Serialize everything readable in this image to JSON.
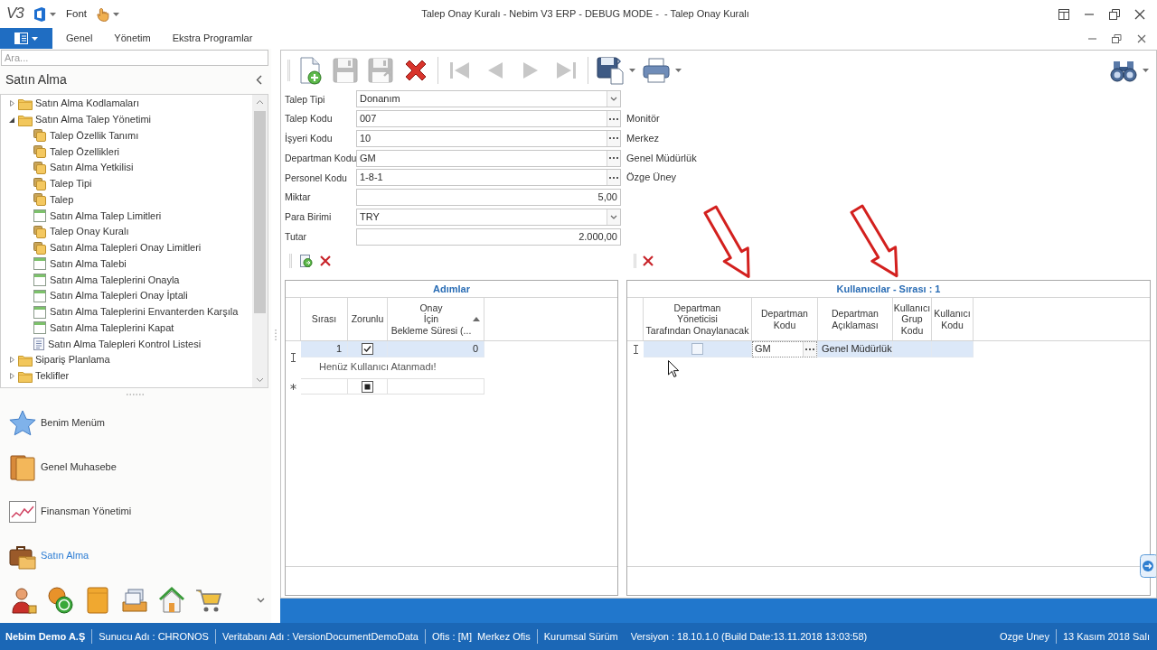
{
  "title_bar": {
    "logo": "V3",
    "menu_label": "Font",
    "title": "Talep Onay Kuralı - Nebim V3 ERP - DEBUG MODE -  - Talep Onay Kuralı"
  },
  "ribbon_tabs": [
    {
      "label": "Genel",
      "selected": false
    },
    {
      "label": "Yönetim",
      "selected": false
    },
    {
      "label": "Ekstra Programlar",
      "selected": false
    }
  ],
  "sidebar": {
    "search": {
      "placeholder": "Ara..."
    },
    "title": "Satın Alma",
    "tree": [
      {
        "label": "Satın Alma Kodlamaları",
        "kind": "folder",
        "expanded": false
      },
      {
        "label": "Satın Alma Talep Yönetimi",
        "kind": "folder",
        "expanded": true,
        "children": [
          {
            "label": "Talep Özellik Tanımı",
            "kind": "module"
          },
          {
            "label": "Talep Özellikleri",
            "kind": "module"
          },
          {
            "label": "Satın Alma Yetkilisi",
            "kind": "module"
          },
          {
            "label": "Talep Tipi",
            "kind": "module"
          },
          {
            "label": "Talep",
            "kind": "module"
          },
          {
            "label": "Satın Alma Talep Limitleri",
            "kind": "form"
          },
          {
            "label": "Talep Onay Kuralı",
            "kind": "module"
          },
          {
            "label": "Satın Alma Talepleri Onay Limitleri",
            "kind": "module"
          },
          {
            "label": "Satın Alma Talebi",
            "kind": "form"
          },
          {
            "label": "Satın Alma Taleplerini Onayla",
            "kind": "form"
          },
          {
            "label": "Satın Alma Talepleri Onay İptali",
            "kind": "form"
          },
          {
            "label": "Satın Alma Taleplerini Envanterden Karşıla",
            "kind": "form"
          },
          {
            "label": "Satın Alma Taleplerini Kapat",
            "kind": "form"
          },
          {
            "label": "Satın Alma Talepleri Kontrol Listesi",
            "kind": "report"
          }
        ]
      },
      {
        "label": "Sipariş Planlama",
        "kind": "folder",
        "expanded": false
      },
      {
        "label": "Teklifler",
        "kind": "folder",
        "expanded": false
      }
    ],
    "nav": [
      {
        "label": "Benim Menüm",
        "selected": false
      },
      {
        "label": "Genel Muhasebe",
        "selected": false
      },
      {
        "label": "Finansman Yönetimi",
        "selected": false
      },
      {
        "label": "Satın Alma",
        "selected": true
      }
    ]
  },
  "toolbar": [
    {
      "disabled": false
    },
    {
      "disabled": true
    },
    {
      "disabled": true
    },
    {
      "disabled": false
    },
    {
      "disabled": true
    },
    {
      "disabled": true
    },
    {
      "disabled": true
    },
    {
      "disabled": true
    },
    {
      "disabled": false
    },
    {
      "disabled": false
    },
    {
      "disabled": false
    }
  ],
  "form": {
    "fields": [
      {
        "label": "Talep Tipi",
        "value": "Donanım",
        "kind": "dropdown"
      },
      {
        "label": "Talep Kodu",
        "value": "007",
        "kind": "lookup",
        "description": "Monitör"
      },
      {
        "label": "İşyeri Kodu",
        "value": "10",
        "kind": "lookup",
        "description": "Merkez"
      },
      {
        "label": "Departman Kodu",
        "value": "GM",
        "kind": "lookup",
        "description": "Genel Müdürlük"
      },
      {
        "label": "Personel Kodu",
        "value": "1-8-1",
        "kind": "lookup",
        "description": "Özge Üney"
      },
      {
        "label": "Miktar",
        "value": "5,00",
        "kind": "number"
      },
      {
        "label": "Para Birimi",
        "value": "TRY",
        "kind": "dropdown"
      },
      {
        "label": "Tutar",
        "value": "2.000,00",
        "kind": "number"
      }
    ]
  },
  "steps": {
    "title": "Adımlar",
    "columns": [
      {
        "label": "Sırası",
        "kind": "number"
      },
      {
        "label": "Zorunlu",
        "kind": "checkbox"
      },
      {
        "label": "Onay\nİçin\nBekleme Süresi (...",
        "kind": "number",
        "sorted": true
      }
    ],
    "rows": [
      {
        "kind": "data",
        "selected": true,
        "editing": true,
        "cells": [
          "1",
          true,
          "0"
        ],
        "detail": "Henüz Kullanıcı Atanmadı!"
      },
      {
        "kind": "new",
        "selected": false,
        "cells": [
          null,
          null
        ]
      }
    ]
  },
  "users": {
    "title": "Kullanıcılar - Sırası : 1",
    "columns": [
      {
        "label": "Departman\nYöneticisi\nTarafından Onaylanacak",
        "kind": "checkbox"
      },
      {
        "label": "Departman\nKodu",
        "kind": "lookup"
      },
      {
        "label": "Departman\nAçıklaması",
        "kind": "text"
      },
      {
        "label": "Kullanıcı\nGrup\nKodu",
        "kind": "text"
      },
      {
        "label": "Kullanıcı\nKodu",
        "kind": "text"
      }
    ],
    "rows": [
      {
        "kind": "data",
        "selected": true,
        "editing": true,
        "cells": [
          false,
          "GM",
          "Genel Müdürlük"
        ]
      }
    ]
  },
  "status_bar": {
    "company": "Nebim Demo A.Ş",
    "items": [
      {
        "text": "Sunucu Adı : CHRONOS",
        "divider": true
      },
      {
        "text": "Veritabanı Adı : VersionDocumentDemoData",
        "divider": true
      },
      {
        "text": "Ofis : [M]  Merkez Ofis",
        "divider": true
      },
      {
        "text": "Kurumsal Sürüm",
        "divider": true
      },
      {
        "text": "Versiyon : 18.10.1.0 (Build Date:13.11.2018 13:03:58)",
        "divider": false
      }
    ],
    "right_items": [
      {
        "text": "Ozge Uney",
        "divider": false
      },
      {
        "text": "13 Kasım 2018 Salı",
        "divider": true
      }
    ]
  }
}
